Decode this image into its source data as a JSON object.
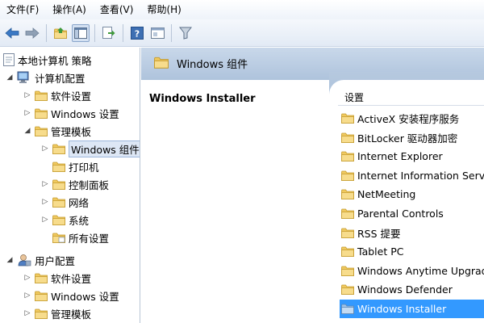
{
  "menubar": {
    "items": [
      "文件(F)",
      "操作(A)",
      "查看(V)",
      "帮助(H)"
    ]
  },
  "toolbar": {
    "icons": [
      "back-arrow-icon",
      "forward-arrow-icon",
      "up-folder-icon",
      "show-hide-tree-icon",
      "export-list-icon",
      "help-icon",
      "properties-icon",
      "filter-icon"
    ]
  },
  "tree": {
    "root": "本地计算机 策略",
    "computer_config": "计算机配置",
    "software_settings": "软件设置",
    "windows_settings": "Windows 设置",
    "admin_templates": "管理模板",
    "windows_components": "Windows 组件",
    "printers": "打印机",
    "control_panel": "控制面板",
    "network": "网络",
    "system": "系统",
    "all_settings": "所有设置",
    "user_config": "用户配置",
    "user_software_settings": "软件设置",
    "user_windows_settings": "Windows 设置",
    "user_admin_templates": "管理模板"
  },
  "right": {
    "header_title": "Windows 组件",
    "desc_title": "Windows Installer",
    "column_header": "设置",
    "items": [
      "ActiveX 安装程序服务",
      "BitLocker 驱动器加密",
      "Internet Explorer",
      "Internet Information Services",
      "NetMeeting",
      "Parental Controls",
      "RSS 提要",
      "Tablet PC",
      "Windows Anytime Upgrade",
      "Windows Defender",
      "Windows Installer"
    ],
    "selected_index": 10
  },
  "colors": {
    "folder": "#f3d27a",
    "folder_dark": "#d9a93a",
    "header_band": "#aec3dc",
    "selection": "#3399ff"
  }
}
